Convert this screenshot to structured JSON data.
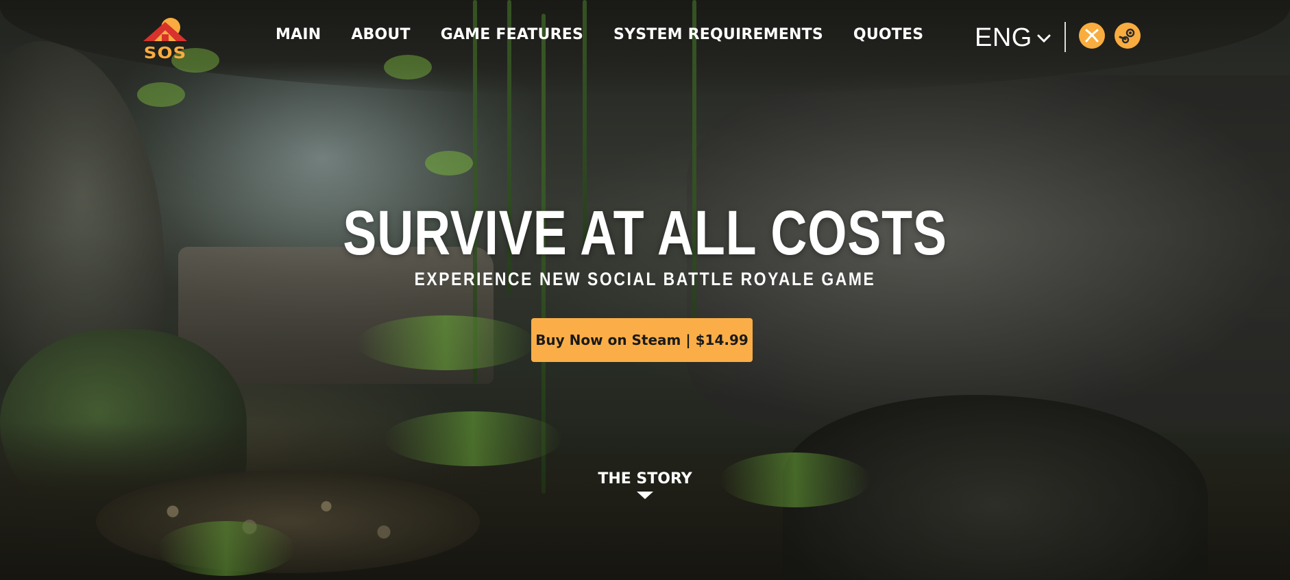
{
  "brand": {
    "logo_text": "SOS",
    "accent_color": "#f9ac3f",
    "icon": "sos-mountain-logo"
  },
  "nav": {
    "items": [
      {
        "label": "MAIN"
      },
      {
        "label": "ABOUT"
      },
      {
        "label": "GAME FEATURES"
      },
      {
        "label": "SYSTEM REQUIREMENTS"
      },
      {
        "label": "QUOTES"
      }
    ]
  },
  "language": {
    "selected": "ENG",
    "icon": "chevron-down-icon"
  },
  "platforms": [
    {
      "name": "xbox",
      "icon": "xbox-icon"
    },
    {
      "name": "steam",
      "icon": "steam-icon"
    }
  ],
  "hero": {
    "title": "SURVIVE AT ALL COSTS",
    "subtitle": "EXPERIENCE NEW SOCIAL BATTLE ROYALE GAME",
    "cta_label": "Buy Now on Steam | $14.99",
    "cta_color": "#fbae47"
  },
  "story": {
    "label": "THE STORY",
    "icon": "triangle-down-icon"
  }
}
